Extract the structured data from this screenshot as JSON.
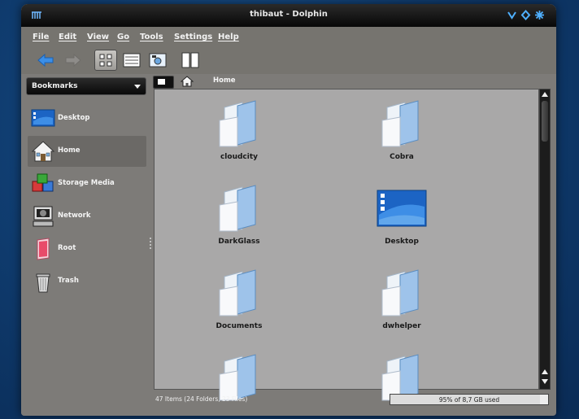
{
  "window": {
    "title": "thibaut - Dolphin"
  },
  "menubar": {
    "items": [
      {
        "label": "File"
      },
      {
        "label": "Edit"
      },
      {
        "label": "View"
      },
      {
        "label": "Go"
      },
      {
        "label": "Tools"
      },
      {
        "label": "Settings"
      },
      {
        "label": "Help"
      }
    ]
  },
  "toolbar": {
    "buttons": [
      {
        "icon": "back-arrow-icon",
        "enabled": true
      },
      {
        "icon": "forward-arrow-icon",
        "enabled": false
      },
      {
        "icon": "icons-view-icon",
        "active": true
      },
      {
        "icon": "details-view-icon",
        "active": false
      },
      {
        "icon": "preview-icon",
        "active": false
      },
      {
        "icon": "split-view-icon",
        "active": false
      }
    ]
  },
  "sidebar": {
    "selector_label": "Bookmarks",
    "items": [
      {
        "label": "Desktop",
        "icon": "desktop-icon"
      },
      {
        "label": "Home",
        "icon": "home-icon",
        "selected": true
      },
      {
        "label": "Storage Media",
        "icon": "storage-media-icon"
      },
      {
        "label": "Network",
        "icon": "network-icon"
      },
      {
        "label": "Root",
        "icon": "root-folder-icon"
      },
      {
        "label": "Trash",
        "icon": "trash-icon"
      }
    ]
  },
  "breadcrumb": {
    "current": "Home",
    "icon": "home-icon"
  },
  "files": [
    {
      "name": "cloudcity",
      "type": "folder"
    },
    {
      "name": "Cobra",
      "type": "folder"
    },
    {
      "name": "DarkGlass",
      "type": "folder"
    },
    {
      "name": "Desktop",
      "type": "desktop"
    },
    {
      "name": "Documents",
      "type": "folder"
    },
    {
      "name": "dwhelper",
      "type": "folder"
    },
    {
      "name": "",
      "type": "folder"
    },
    {
      "name": "",
      "type": "folder"
    }
  ],
  "status": {
    "summary": "47 Items (24 Folders, 23 Files)",
    "capacity_text": "95% of 8,7 GB used",
    "capacity_used_fraction": 0.95
  },
  "colors": {
    "accent": "#2a7fd6",
    "folder_blue": "#9ec3ea"
  }
}
